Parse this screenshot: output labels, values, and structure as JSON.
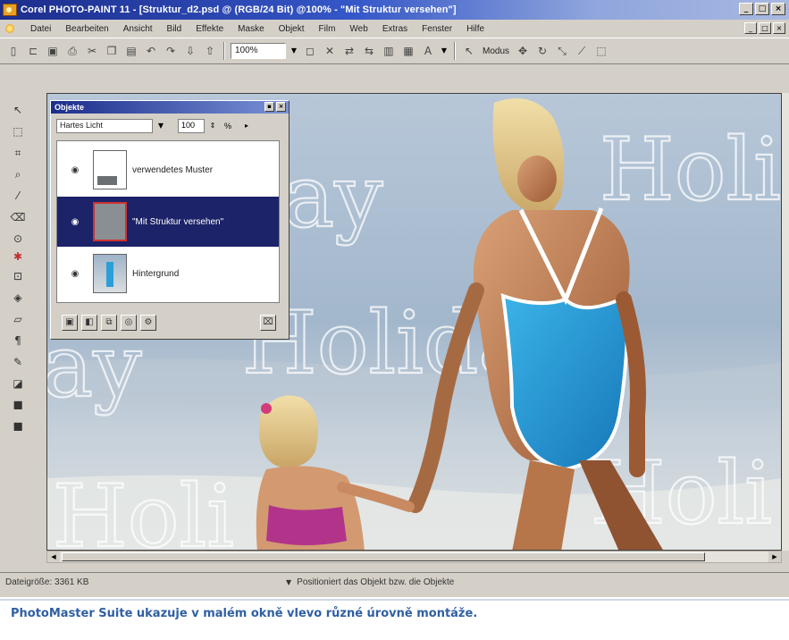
{
  "window": {
    "title": "Corel PHOTO-PAINT 11 - [Struktur_d2.psd @ (RGB/24 Bit) @100% - \"Mit Struktur versehen\"]",
    "controls": [
      "_",
      "□",
      "×"
    ]
  },
  "menu": {
    "items": [
      "Datei",
      "Bearbeiten",
      "Ansicht",
      "Bild",
      "Effekte",
      "Maske",
      "Objekt",
      "Film",
      "Web",
      "Extras",
      "Fenster",
      "Hilfe"
    ],
    "mdi_controls": [
      "_",
      "□",
      "×"
    ]
  },
  "toolbar": {
    "zoom_value": "100%",
    "mode_label": "Modus"
  },
  "objects_docker": {
    "title": "Objekte",
    "merge_mode": "Hartes Licht",
    "opacity": "100",
    "opacity_unit": "%",
    "layers": [
      {
        "name": "verwendetes Muster",
        "selected": false
      },
      {
        "name": "\"Mit Struktur versehen\"",
        "selected": true
      },
      {
        "name": "Hintergrund",
        "selected": false
      }
    ]
  },
  "canvas": {
    "watermark_text": "Holiday",
    "fragments": [
      "ay",
      "Holi",
      "ay",
      "Holiday",
      "Holi",
      "Holi"
    ]
  },
  "status": {
    "file_size": "Dateigröße: 3361 KB",
    "message": "Positioniert das Objekt bzw. die Objekte"
  },
  "caption": {
    "text": "PhotoMaster Suite ukazuje v malém okně vlevo různé úrovně montáže."
  },
  "colors": {
    "title_bar": "#1c2d8c",
    "swimsuit": "#2a9fd8",
    "caption": "#2f5fa3",
    "selected_layer": "#1c2368"
  }
}
